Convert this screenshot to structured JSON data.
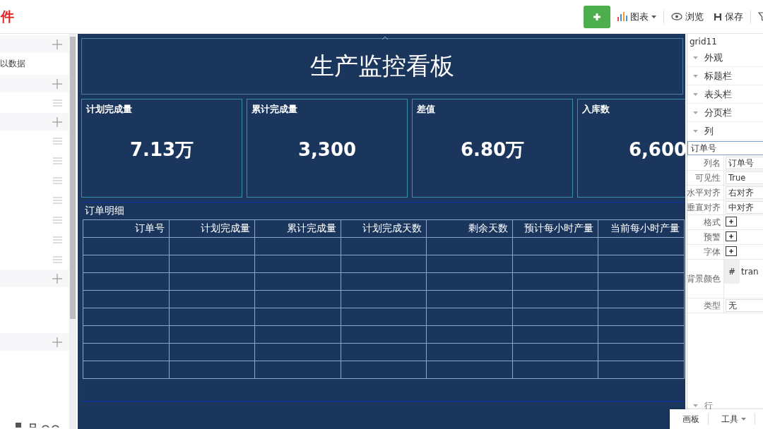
{
  "app": {
    "title_fragment": "件"
  },
  "toolbar": {
    "buttons": [
      {
        "kind": "add"
      },
      {
        "kind": "chart",
        "label": "图表",
        "dropdown": true
      },
      {
        "kind": "preview",
        "label": "浏览",
        "dropdown": false
      },
      {
        "kind": "save",
        "label": "保存",
        "dropdown": false
      },
      {
        "kind": "filter"
      }
    ]
  },
  "left_panel": {
    "items": [
      {
        "kind": "add"
      },
      {
        "kind": "label",
        "label": "以数据"
      },
      {
        "kind": "add"
      },
      {
        "kind": "drag"
      },
      {
        "kind": "add"
      },
      {
        "kind": "drag"
      },
      {
        "kind": "drag"
      },
      {
        "kind": "drag"
      },
      {
        "kind": "drag"
      },
      {
        "kind": "drag"
      },
      {
        "kind": "drag"
      },
      {
        "kind": "drag"
      },
      {
        "kind": "add"
      },
      {
        "kind": "add"
      }
    ]
  },
  "board": {
    "title": "生产监控看板",
    "kpis": [
      {
        "label": "计划完成量",
        "value": "7.13万"
      },
      {
        "label": "累计完成量",
        "value": "3,300"
      },
      {
        "label": "差值",
        "value": "6.80万"
      },
      {
        "label": "入库数",
        "value": "6,600"
      }
    ],
    "table": {
      "title": "订单明细",
      "columns": [
        "订单号",
        "计划完成量",
        "累计完成量",
        "计划完成天数",
        "剩余天数",
        "预计每小时产量",
        "当前每小时产量"
      ]
    }
  },
  "properties": {
    "component": "grid11",
    "sections": [
      "外观",
      "标题栏",
      "表头栏",
      "分页栏",
      "列"
    ],
    "column_select": "订单号",
    "fields": [
      {
        "kind": "text",
        "label": "列名",
        "value": "订单号"
      },
      {
        "kind": "text",
        "label": "可见性",
        "value": "True"
      },
      {
        "kind": "text",
        "label": "水平对齐",
        "value": "右对齐"
      },
      {
        "kind": "text",
        "label": "垂直对齐",
        "value": "中对齐"
      },
      {
        "kind": "button",
        "label": "格式"
      },
      {
        "kind": "button",
        "label": "预警"
      },
      {
        "kind": "button",
        "label": "字体"
      },
      {
        "kind": "color",
        "label": "背景颜色",
        "prefix": "#",
        "value": "tran"
      },
      {
        "kind": "text",
        "label": "类型",
        "value": "无"
      }
    ],
    "next_section": "行"
  },
  "bottom_tabs": [
    {
      "label": "画板",
      "dropdown": false
    },
    {
      "label": "工具",
      "dropdown": true
    }
  ]
}
